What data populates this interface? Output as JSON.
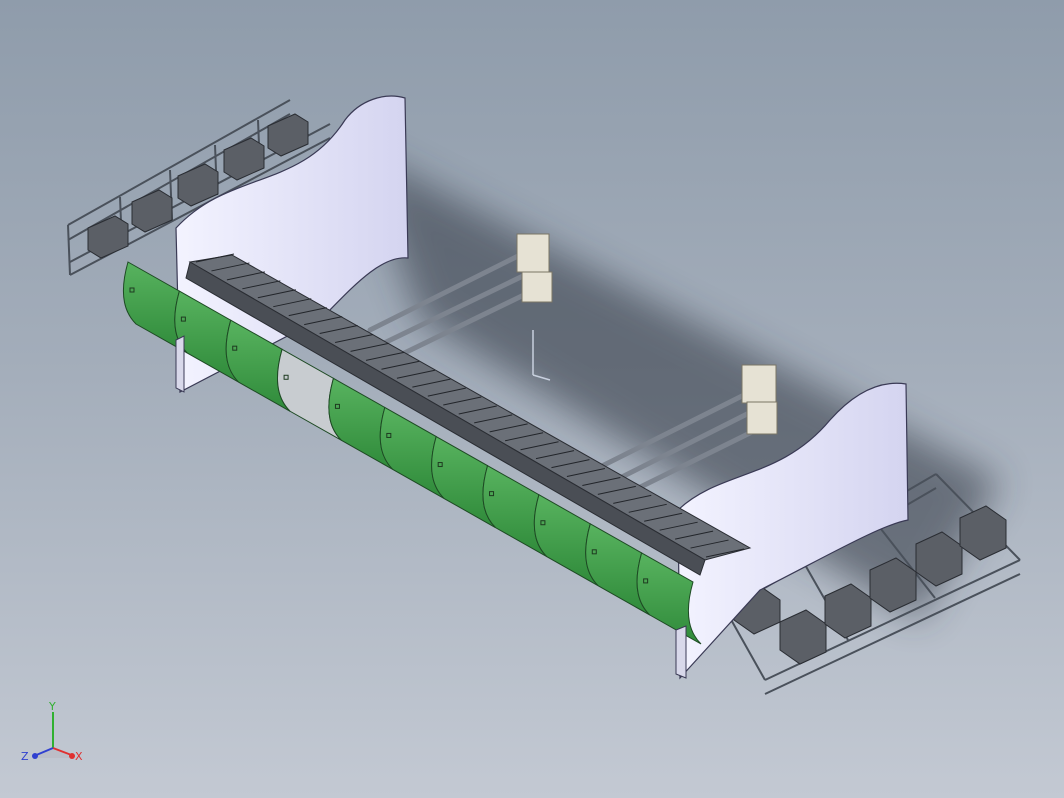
{
  "viewport": {
    "background_top": "#8f9cab",
    "background_bottom": "#c3c9d3"
  },
  "model": {
    "panel_color": "#e2e2fa",
    "cover_color": "#3f9f4a",
    "cover_open_color": "#c8ccd0",
    "rail_color": "#6c7480",
    "box_color": "#5b5f66"
  },
  "triad": {
    "x_label": "X",
    "y_label": "Y",
    "z_label": "Z",
    "x_color": "#e03030",
    "y_color": "#30b030",
    "z_color": "#3040d0"
  }
}
